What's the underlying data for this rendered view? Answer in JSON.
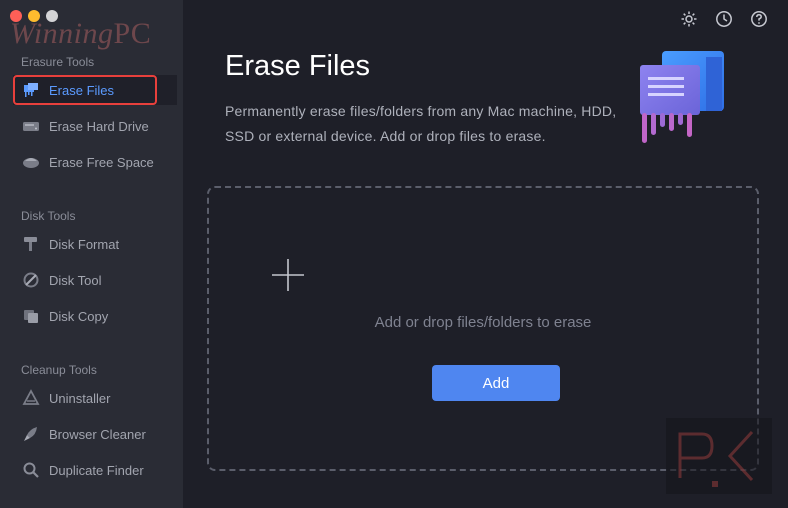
{
  "watermark": {
    "script": "Winning",
    "pc": "PC"
  },
  "sidebar": {
    "groups": [
      {
        "title": "Erasure Tools",
        "items": [
          {
            "label": "Erase Files",
            "icon": "erase-files-icon",
            "active": true
          },
          {
            "label": "Erase Hard Drive",
            "icon": "hard-drive-icon"
          },
          {
            "label": "Erase Free Space",
            "icon": "free-space-icon"
          }
        ]
      },
      {
        "title": "Disk Tools",
        "items": [
          {
            "label": "Disk Format",
            "icon": "disk-format-icon"
          },
          {
            "label": "Disk Tool",
            "icon": "disk-tool-icon"
          },
          {
            "label": "Disk Copy",
            "icon": "disk-copy-icon"
          }
        ]
      },
      {
        "title": "Cleanup Tools",
        "items": [
          {
            "label": "Uninstaller",
            "icon": "uninstaller-icon"
          },
          {
            "label": "Browser Cleaner",
            "icon": "browser-cleaner-icon"
          },
          {
            "label": "Duplicate Finder",
            "icon": "duplicate-finder-icon"
          }
        ]
      }
    ]
  },
  "header": {
    "title": "Erase Files",
    "description": "Permanently erase files/folders from any Mac machine, HDD, SSD or external device. Add or drop files to erase."
  },
  "dropzone": {
    "hint": "Add or drop files/folders to erase",
    "add_label": "Add"
  },
  "top_icons": [
    "settings-icon",
    "history-icon",
    "help-icon"
  ],
  "colors": {
    "accent": "#4f86f0",
    "active_text": "#5b9bff",
    "highlight_border": "#e8403c"
  }
}
